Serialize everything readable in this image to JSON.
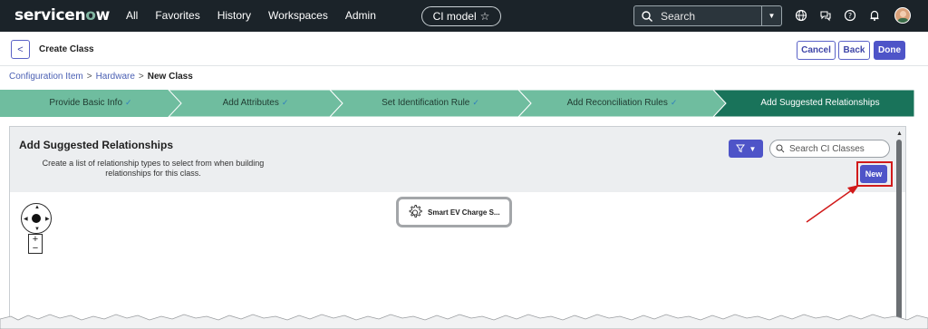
{
  "topnav": {
    "brand": "servicenow",
    "links": [
      "All",
      "Favorites",
      "History",
      "Workspaces",
      "Admin"
    ],
    "context_pill": "CI model",
    "search_placeholder": "Search"
  },
  "header": {
    "title": "Create Class",
    "cancel": "Cancel",
    "back": "Back",
    "done": "Done"
  },
  "breadcrumb": {
    "items": [
      "Configuration Item",
      "Hardware"
    ],
    "current": "New Class",
    "separator": ">"
  },
  "stepper": {
    "steps": [
      {
        "label": "Provide Basic Info",
        "done": true
      },
      {
        "label": "Add Attributes",
        "done": true
      },
      {
        "label": "Set Identification Rule",
        "done": true
      },
      {
        "label": "Add Reconciliation Rules",
        "done": true
      },
      {
        "label": "Add Suggested Relationships",
        "done": false,
        "active": true
      }
    ],
    "check_mark": "✓"
  },
  "panel": {
    "title": "Add Suggested Relationships",
    "description": "Create a list of relationship types to select from when building relationships for this class.",
    "search_placeholder": "Search CI Classes",
    "new_button": "New"
  },
  "canvas": {
    "node_label": "Smart EV Charge S...",
    "zoom_in": "+",
    "zoom_out": "−"
  },
  "colors": {
    "nav_bg": "#1b2329",
    "accent": "#4e54c8",
    "step_done": "#6fbd9f",
    "step_active": "#19735a",
    "highlight": "#d11a1a"
  }
}
